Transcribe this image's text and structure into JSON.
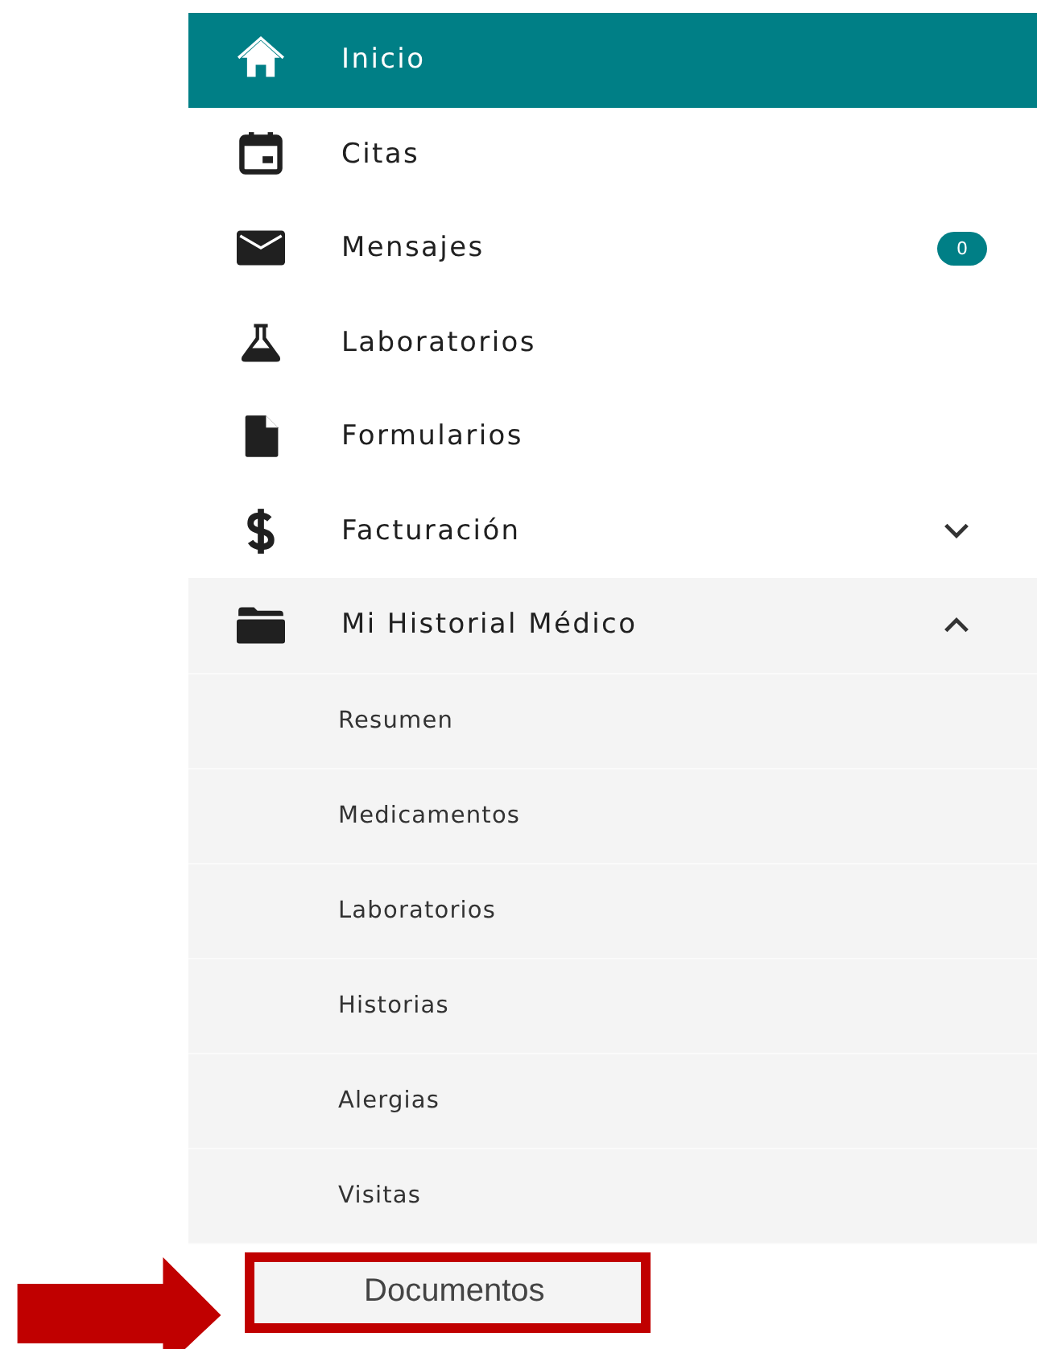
{
  "sidebar": {
    "items": [
      {
        "label": "Inicio",
        "selected": true
      },
      {
        "label": "Citas",
        "selected": false
      },
      {
        "label": "Mensajes",
        "selected": false,
        "badge": "0"
      },
      {
        "label": "Laboratorios",
        "selected": false
      },
      {
        "label": "Formularios",
        "selected": false
      },
      {
        "label": "Facturación",
        "selected": false,
        "expanded": false
      },
      {
        "label": "Mi Historial Médico",
        "selected": false,
        "expanded": true,
        "children": [
          {
            "label": "Resumen",
            "highlighted": false
          },
          {
            "label": "Medicamentos",
            "highlighted": false
          },
          {
            "label": "Laboratorios",
            "highlighted": false
          },
          {
            "label": "Historias",
            "highlighted": false
          },
          {
            "label": "Alergias",
            "highlighted": false
          },
          {
            "label": "Visitas",
            "highlighted": false
          },
          {
            "label": "Documentos",
            "highlighted": true
          }
        ]
      }
    ]
  }
}
